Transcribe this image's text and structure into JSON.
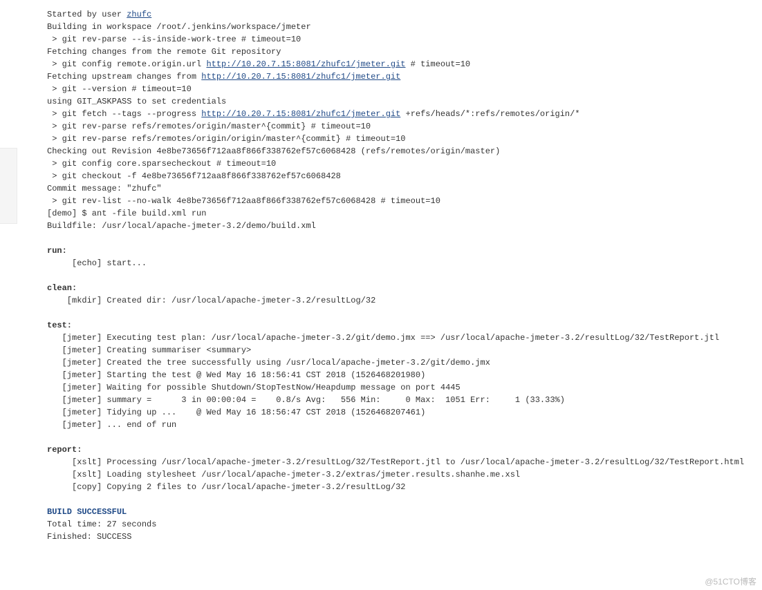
{
  "watermark": "@51CTO博客",
  "console": {
    "l1_prefix": "Started by user ",
    "l1_user": "zhufc",
    "l2": "Building in workspace /root/.jenkins/workspace/jmeter",
    "l3": " > git rev-parse --is-inside-work-tree # timeout=10",
    "l4": "Fetching changes from the remote Git repository",
    "l5_prefix": " > git config remote.origin.url ",
    "l5_url": "http://10.20.7.15:8081/zhufc1/jmeter.git",
    "l5_suffix": " # timeout=10",
    "l6_prefix": "Fetching upstream changes from ",
    "l6_url": "http://10.20.7.15:8081/zhufc1/jmeter.git",
    "l7": " > git --version # timeout=10",
    "l8": "using GIT_ASKPASS to set credentials ",
    "l9_prefix": " > git fetch --tags --progress ",
    "l9_url": "http://10.20.7.15:8081/zhufc1/jmeter.git",
    "l9_suffix": " +refs/heads/*:refs/remotes/origin/*",
    "l10": " > git rev-parse refs/remotes/origin/master^{commit} # timeout=10",
    "l11": " > git rev-parse refs/remotes/origin/origin/master^{commit} # timeout=10",
    "l12": "Checking out Revision 4e8be73656f712aa8f866f338762ef57c6068428 (refs/remotes/origin/master)",
    "l13": " > git config core.sparsecheckout # timeout=10",
    "l14": " > git checkout -f 4e8be73656f712aa8f866f338762ef57c6068428",
    "l15": "Commit message: \"zhufc\"",
    "l16": " > git rev-list --no-walk 4e8be73656f712aa8f866f338762ef57c6068428 # timeout=10",
    "l17": "[demo] $ ant -file build.xml run",
    "l18": "Buildfile: /usr/local/apache-jmeter-3.2/demo/build.xml",
    "t_run": "run:",
    "l19": "     [echo] start...",
    "t_clean": "clean:",
    "l20": "    [mkdir] Created dir: /usr/local/apache-jmeter-3.2/resultLog/32",
    "t_test": "test:",
    "l21": "   [jmeter] Executing test plan: /usr/local/apache-jmeter-3.2/git/demo.jmx ==> /usr/local/apache-jmeter-3.2/resultLog/32/TestReport.jtl",
    "l22": "   [jmeter] Creating summariser <summary>",
    "l23": "   [jmeter] Created the tree successfully using /usr/local/apache-jmeter-3.2/git/demo.jmx",
    "l24": "   [jmeter] Starting the test @ Wed May 16 18:56:41 CST 2018 (1526468201980)",
    "l25": "   [jmeter] Waiting for possible Shutdown/StopTestNow/Heapdump message on port 4445",
    "l26": "   [jmeter] summary =      3 in 00:00:04 =    0.8/s Avg:   556 Min:     0 Max:  1051 Err:     1 (33.33%)",
    "l27": "   [jmeter] Tidying up ...    @ Wed May 16 18:56:47 CST 2018 (1526468207461)",
    "l28": "   [jmeter] ... end of run",
    "t_report": "report:",
    "l29": "     [xslt] Processing /usr/local/apache-jmeter-3.2/resultLog/32/TestReport.jtl to /usr/local/apache-jmeter-3.2/resultLog/32/TestReport.html",
    "l30": "     [xslt] Loading stylesheet /usr/local/apache-jmeter-3.2/extras/jmeter.results.shanhe.me.xsl",
    "l31": "     [copy] Copying 2 files to /usr/local/apache-jmeter-3.2/resultLog/32",
    "l32": "BUILD SUCCESSFUL",
    "l33": "Total time: 27 seconds",
    "l34": "Finished: SUCCESS"
  }
}
